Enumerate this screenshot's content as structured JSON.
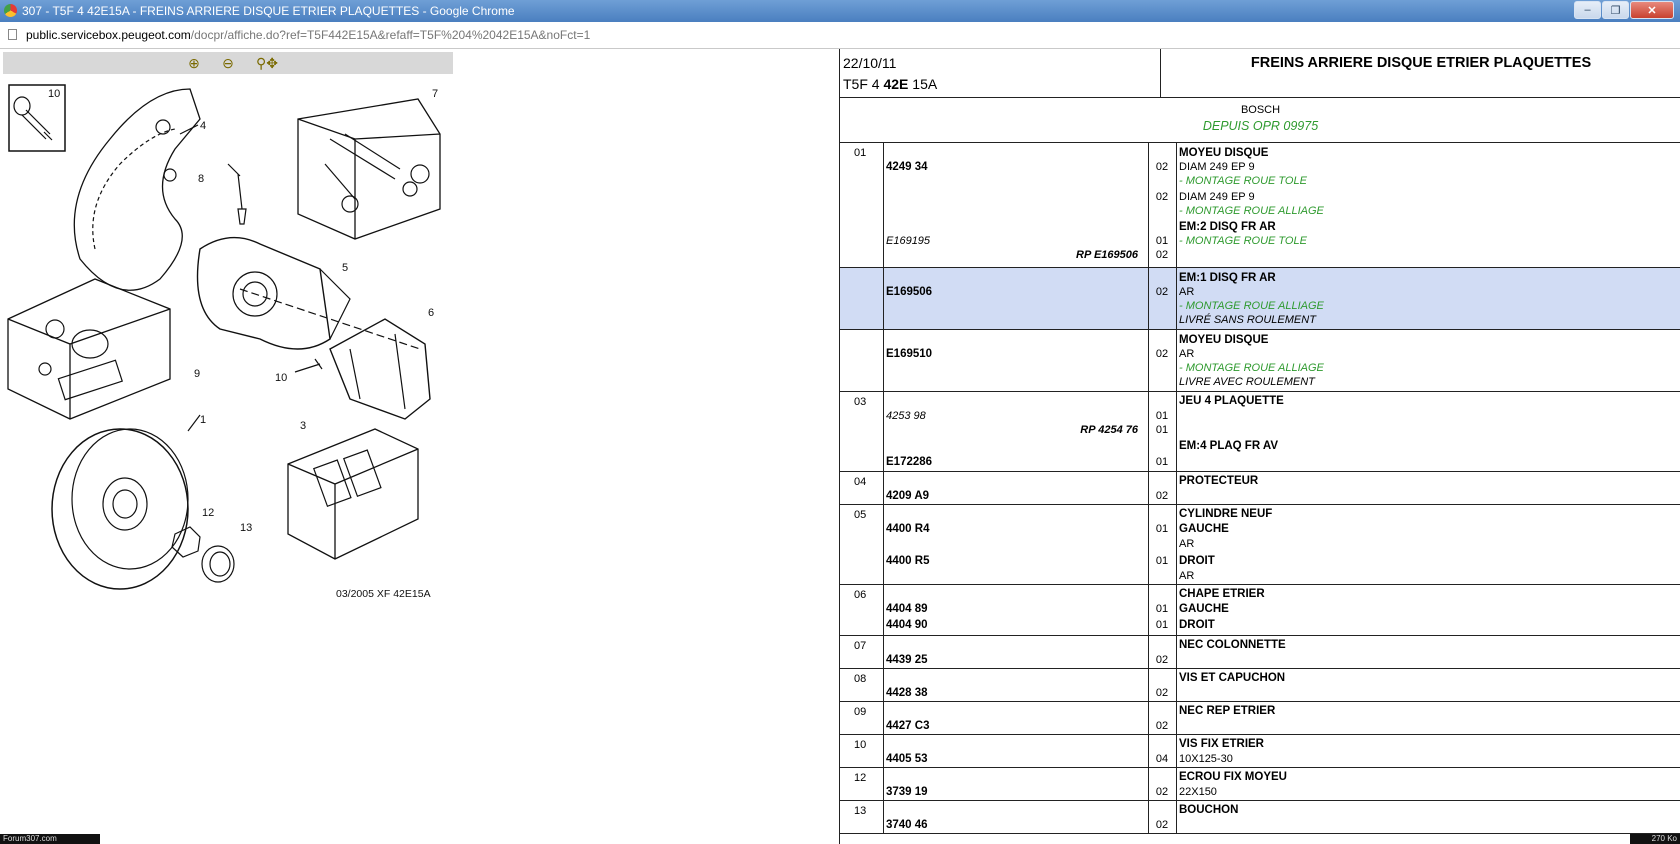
{
  "window": {
    "title": "307 - T5F 4 42E15A - FREINS ARRIERE DISQUE ETRIER PLAQUETTES - Google Chrome",
    "url_host": "public.servicebox.peugeot.com",
    "url_path": "/docpr/affiche.do?ref=T5F442E15A&refaff=T5F%204%2042E15A&noFct=1"
  },
  "toolbar": {
    "zoom_in": "zoom-in-icon",
    "zoom_out": "zoom-out-icon",
    "pan": "pan-zoom-icon"
  },
  "diagram": {
    "caption": "03/2005  XF 42E15A",
    "labels": [
      "10",
      "4",
      "7",
      "8",
      "5",
      "6",
      "9",
      "10",
      "1",
      "3",
      "12",
      "13"
    ]
  },
  "header": {
    "date": "22/10/11",
    "code_prefix": "T5F 4 ",
    "code_bold": "42E",
    "code_suffix": " 15A",
    "title": "FREINS ARRIERE DISQUE ETRIER PLAQUETTES",
    "brand": "BOSCH",
    "since": "DEPUIS OPR 09975"
  },
  "rows": {
    "r01": {
      "pos": "01",
      "ref1": "4249 34",
      "q1": "02",
      "d1": "MOYEU DISQUE",
      "d2": "DIAM 249 EP 9",
      "g1": "- MONTAGE ROUE TOLE",
      "q2": "02",
      "d3": "DIAM 249 EP 9",
      "g2": "- MONTAGE ROUE ALLIAGE",
      "d4": "EM:2 DISQ FR AR",
      "ref2": "E169195",
      "q3": "01",
      "g3": "- MONTAGE ROUE TOLE",
      "rp": "RP E169506",
      "q4": "02"
    },
    "r01b": {
      "ref": "E169506",
      "q": "02",
      "d1": "EM:1 DISQ FR AR",
      "d2": "AR",
      "g1": "- MONTAGE ROUE ALLIAGE",
      "d3": "LIVRÉ SANS ROULEMENT"
    },
    "r01c": {
      "ref": "E169510",
      "q": "02",
      "d1": "MOYEU DISQUE",
      "d2": "AR",
      "g1": "- MONTAGE ROUE ALLIAGE",
      "d3": "LIVRE AVEC ROULEMENT"
    },
    "r03": {
      "pos": "03",
      "d1": "JEU 4 PLAQUETTE",
      "ref1": "4253 98",
      "q1": "01",
      "rp": "RP 4254 76",
      "q2": "01",
      "d2": "EM:4 PLAQ FR AV",
      "ref2": "E172286",
      "q3": "01"
    },
    "r04": {
      "pos": "04",
      "d1": "PROTECTEUR",
      "ref": "4209 A9",
      "q": "02"
    },
    "r05": {
      "pos": "05",
      "d1": "CYLINDRE NEUF",
      "ref1": "4400 R4",
      "q1": "01",
      "d2": "GAUCHE",
      "d3": "AR",
      "ref2": "4400 R5",
      "q2": "01",
      "d4": "DROIT",
      "d5": "AR"
    },
    "r06": {
      "pos": "06",
      "d1": "CHAPE ETRIER",
      "ref1": "4404 89",
      "q1": "01",
      "d2": "GAUCHE",
      "ref2": "4404 90",
      "q2": "01",
      "d3": "DROIT"
    },
    "r07": {
      "pos": "07",
      "d1": "NEC COLONNETTE",
      "ref": "4439 25",
      "q": "02"
    },
    "r08": {
      "pos": "08",
      "d1": "VIS ET CAPUCHON",
      "ref": "4428 38",
      "q": "02"
    },
    "r09": {
      "pos": "09",
      "d1": "NEC REP ETRIER",
      "ref": "4427 C3",
      "q": "02"
    },
    "r10": {
      "pos": "10",
      "d1": "VIS FIX ETRIER",
      "d2": "10X125-30",
      "ref": "4405 53",
      "q": "04"
    },
    "r12": {
      "pos": "12",
      "d1": "ECROU FIX MOYEU",
      "d2": "22X150",
      "ref": "3739 19",
      "q": "02"
    },
    "r13": {
      "pos": "13",
      "d1": "BOUCHON",
      "ref": "3740 46",
      "q": "02"
    }
  },
  "footer": {
    "left": "Forum307.com",
    "right": "270 Ko"
  },
  "colors": {
    "highlight": "#d1dcf4",
    "green": "#2e9a2e"
  }
}
